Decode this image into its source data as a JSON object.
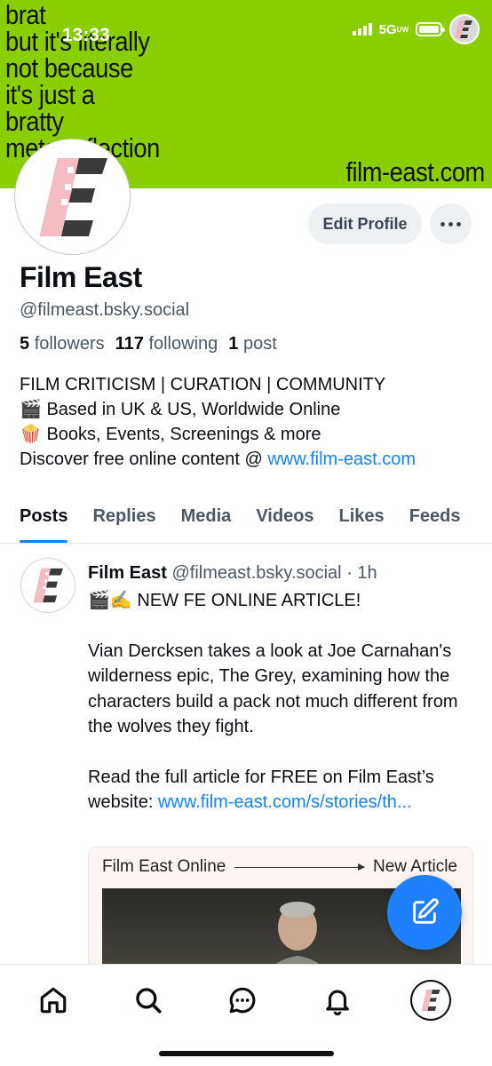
{
  "status_bar": {
    "time": "13:33",
    "network": "5G",
    "network_sub": "UW",
    "signal_bars": 4,
    "battery_level": 1.0
  },
  "banner": {
    "text": "brat\nbut it's literally\nnot because\nit's just a\nbratty\nmeta-reflection",
    "url": "film-east.com",
    "color": "#8ace00"
  },
  "profile": {
    "display_name": "Film East",
    "handle": "@filmeast.bsky.social",
    "followers_count": "5",
    "followers_label": "followers",
    "following_count": "117",
    "following_label": "following",
    "posts_count": "1",
    "posts_label": "post",
    "edit_label": "Edit Profile",
    "bio": {
      "line1": "FILM CRITICISM | CURATION | COMMUNITY",
      "line2_icon": "🎬",
      "line2": "Based in UK & US, Worldwide Online",
      "line3_icon": "🍿",
      "line3": "Books, Events, Screenings & more",
      "line4": "Discover free online content @ ",
      "line4_link": "www.film-east.com"
    }
  },
  "tabs": [
    {
      "label": "Posts",
      "active": true
    },
    {
      "label": "Replies"
    },
    {
      "label": "Media"
    },
    {
      "label": "Videos"
    },
    {
      "label": "Likes"
    },
    {
      "label": "Feeds"
    }
  ],
  "post": {
    "author": "Film East",
    "handle": "@filmeast.bsky.social",
    "separator": "·",
    "time": "1h",
    "icons": "🎬✍️",
    "line1": "NEW FE ONLINE ARTICLE!",
    "paragraph": "Vian Dercksen takes a look at Joe Carnahan's wilderness epic, The Grey, examining how the characters build a pack not much different from the wolves they fight.",
    "read_more": "Read the full article for FREE on Film East’s website: ",
    "link": "www.film-east.com/s/stories/th...",
    "embed_left": "Film East Online",
    "embed_right": "New Article"
  },
  "colors": {
    "accent": "#1083fe",
    "fab": "#1e80ff",
    "muted": "#4b5866"
  },
  "nav_icons": [
    "home-icon",
    "search-icon",
    "chat-icon",
    "bell-icon",
    "profile-avatar-icon"
  ]
}
